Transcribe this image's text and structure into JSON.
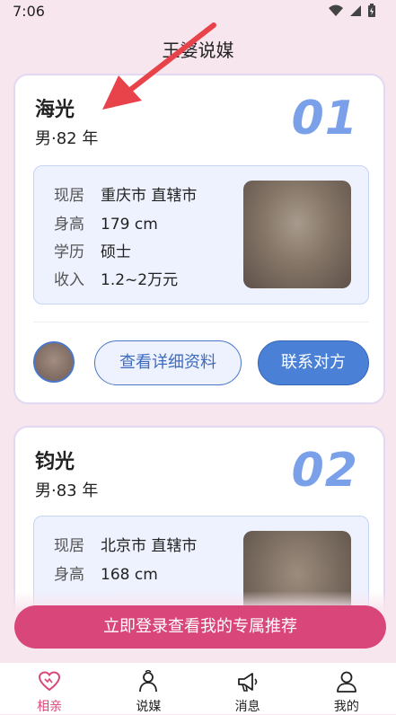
{
  "status_bar": {
    "time": "7:06"
  },
  "app": {
    "title": "王婆说媒"
  },
  "profiles": [
    {
      "name": "海光",
      "meta": "男·82 年",
      "rank": "01",
      "residence_label": "现居",
      "residence": "重庆市 直辖市",
      "height_label": "身高",
      "height": "179 cm",
      "education_label": "学历",
      "education": "硕士",
      "income_label": "收入",
      "income": "1.2~2万元",
      "detail_button": "查看详细资料",
      "contact_button": "联系对方"
    },
    {
      "name": "钧光",
      "meta": "男·83 年",
      "rank": "02",
      "residence_label": "现居",
      "residence": "北京市 直辖市",
      "height_label": "身高",
      "height": "168 cm"
    }
  ],
  "login_prompt": "立即登录查看我的专属推荐",
  "nav": {
    "items": [
      {
        "label": "相亲",
        "icon": "heart-icon",
        "active": true
      },
      {
        "label": "说媒",
        "icon": "matchmaker-icon",
        "active": false
      },
      {
        "label": "消息",
        "icon": "megaphone-icon",
        "active": false
      },
      {
        "label": "我的",
        "icon": "person-icon",
        "active": false
      }
    ]
  },
  "colors": {
    "background": "#f8e6ee",
    "accent_pink": "#d9477a",
    "accent_blue": "#4a80d6",
    "rank_blue": "#7aa0ea",
    "annotation_red": "#e8434a"
  }
}
